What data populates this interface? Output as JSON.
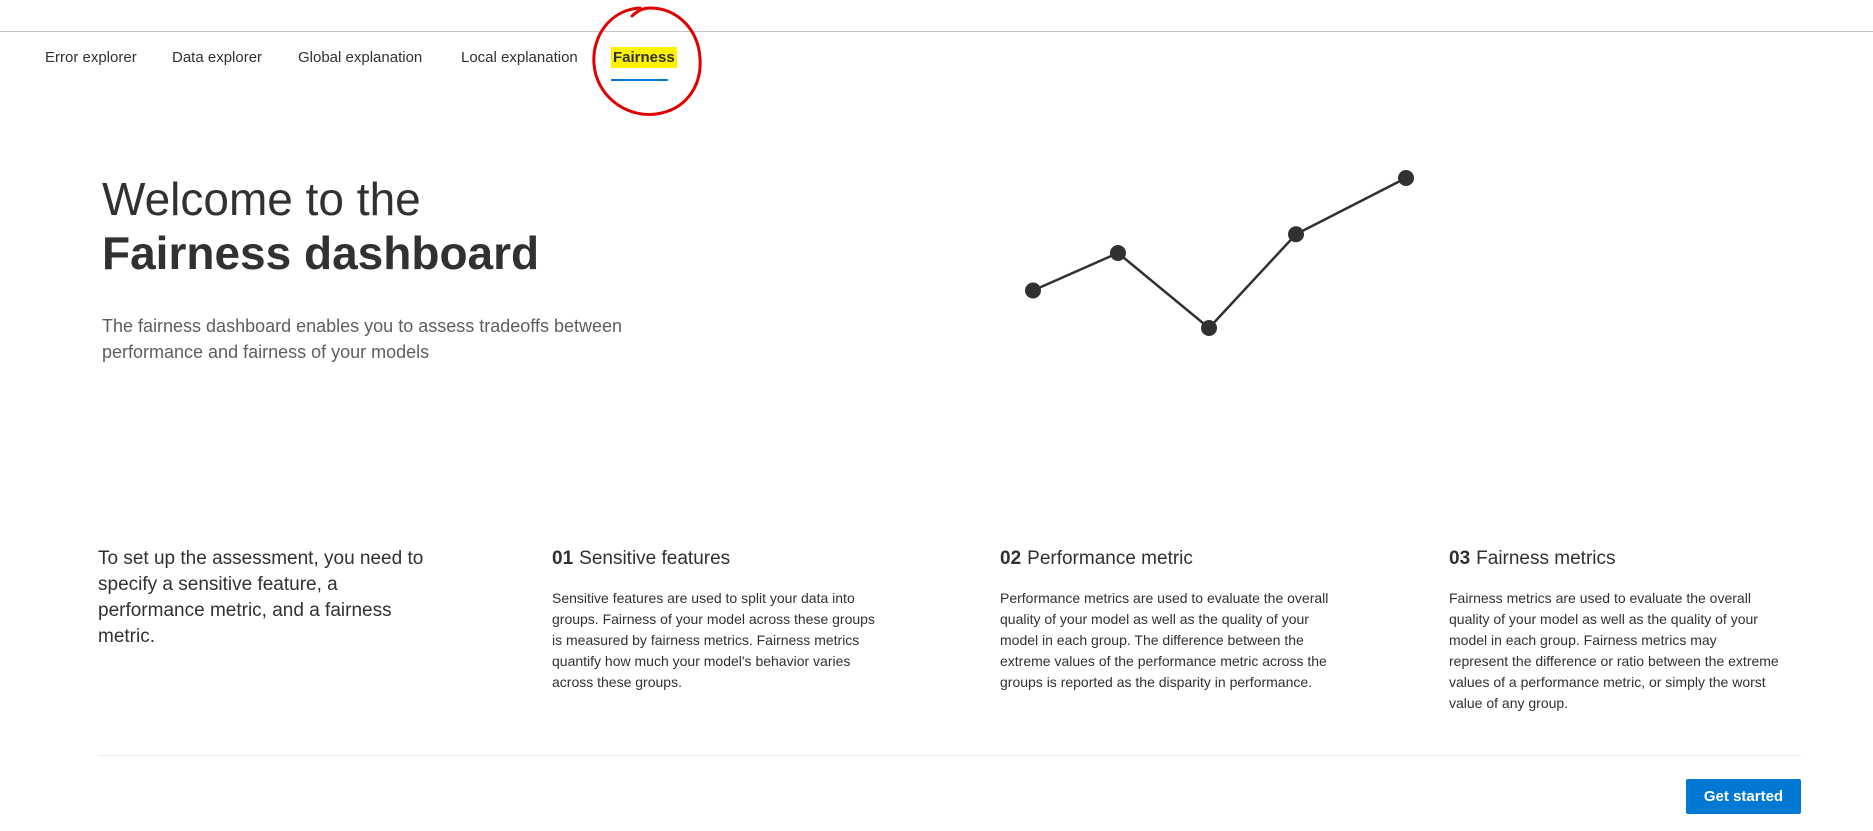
{
  "tabs": [
    {
      "label": "Error explorer"
    },
    {
      "label": "Data explorer"
    },
    {
      "label": "Global explanation"
    },
    {
      "label": "Local explanation"
    },
    {
      "label": "Fairness",
      "selected": true
    }
  ],
  "hero": {
    "title_light": "Welcome to the",
    "title_bold": "Fairness dashboard",
    "description": "The fairness dashboard enables you to assess tradeoffs between performance and fairness of your models"
  },
  "intro": "To set up the assessment, you need to specify a sensitive feature, a performance metric, and a fairness metric.",
  "steps": [
    {
      "number": "01",
      "title": "Sensitive features",
      "body": "Sensitive features are used to split your data into groups. Fairness of your model across these groups is measured by fairness metrics. Fairness metrics quantify how much your model's behavior varies across these groups."
    },
    {
      "number": "02",
      "title": "Performance metric",
      "body": "Performance metrics are used to evaluate the overall quality of your model as well as the quality of your model in each group. The difference between the extreme values of the performance metric across the groups is reported as the disparity in performance."
    },
    {
      "number": "03",
      "title": "Fairness metrics",
      "body": "Fairness metrics are used to evaluate the overall quality of your model as well as the quality of your model in each group. Fairness metrics may represent the difference or ratio between the extreme values of a performance metric, or simply the worst value of any group."
    }
  ],
  "actions": {
    "get_started": "Get started"
  },
  "decoration": {
    "line_points": [
      2,
      3,
      1,
      3.5,
      5
    ],
    "line_color": "#323130",
    "highlight_color": "#fff200",
    "annotation_color": "#e00000",
    "accent_color": "#0078d4"
  }
}
